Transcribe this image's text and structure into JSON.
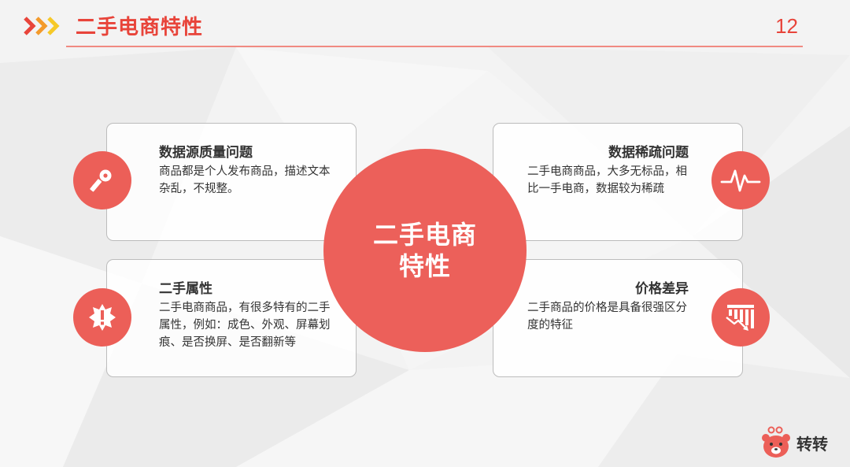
{
  "header": {
    "title": "二手电商特性",
    "page_number": "12"
  },
  "center": {
    "line1": "二手电商",
    "line2": "特性"
  },
  "cards": [
    {
      "title": "数据源质量问题",
      "desc": "商品都是个人发布商品，描述文本杂乱，不规整。",
      "icon": "key-icon"
    },
    {
      "title": "二手属性",
      "desc": "二手电商商品，有很多特有的二手属性，例如：成色、外观、屏幕划痕、是否换屏、是否翻新等",
      "icon": "alert-burst-icon"
    },
    {
      "title": "数据稀疏问题",
      "desc": "二手电商商品，大多无标品，相比一手电商，数据较为稀疏",
      "icon": "pulse-icon"
    },
    {
      "title": "价格差异",
      "desc": "二手商品的价格是具备很强区分度的特征",
      "icon": "price-drop-chart-icon"
    }
  ],
  "brand": {
    "name": "转转"
  },
  "colors": {
    "accent": "#e8443a",
    "circle": "#ec605a",
    "chevron_red": "#e8443a",
    "chevron_orange": "#f39a2b",
    "chevron_yellow": "#f6c928"
  }
}
